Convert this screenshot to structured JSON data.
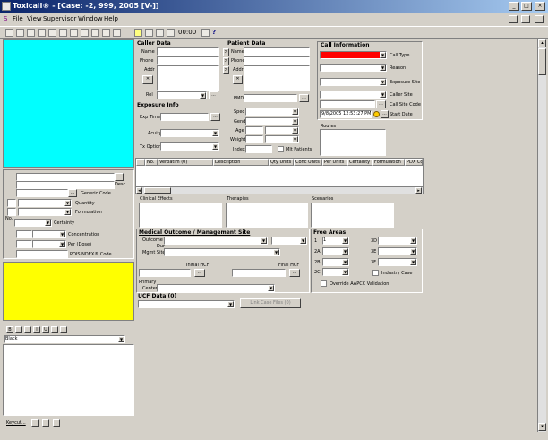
{
  "window": {
    "title": "Toxicall® - [Case: -2, 999, 2005 [V-]]"
  },
  "menu": [
    "File",
    "View",
    "Supervisor",
    "Window",
    "Help"
  ],
  "toolbar": {
    "timer": "00:00"
  },
  "caller": {
    "header": "Caller Data",
    "name_label": "Name",
    "phone_label": "Phone",
    "addr_label": "Addr",
    "rel_label": "Rel"
  },
  "patient": {
    "header": "Patient Data",
    "name_label": "Name",
    "phone_label": "Phone",
    "addr_label": "Addr",
    "pmd_label": "PMD",
    "spec_label": "Spec",
    "gend_label": "Gend",
    "age_label": "Age",
    "weight_label": "Weight",
    "indexr_label": "Index",
    "mult_label": "Mlt Patients"
  },
  "call_info": {
    "header": "Call Information",
    "call_type": "Call Type",
    "reason": "Reason",
    "exposure_site": "Exposure Site",
    "caller_site": "Caller Site",
    "call_site_code": "Call Site Code",
    "start_date_value": "9/8/2005 12:53:27 PM",
    "start_date_label": "Start Date"
  },
  "exposure": {
    "header": "Exposure Info",
    "exp_time": "Exp Time",
    "acuity": "Acuity",
    "tx_option": "Tx Option"
  },
  "routes": {
    "label": "Routes"
  },
  "grid": {
    "columns": [
      "No.",
      "Verbatim (0)",
      "Description",
      "Qty Units",
      "Conc Units",
      "Per Units",
      "Certainty",
      "Formulation",
      "PDX Co"
    ]
  },
  "effects": {
    "clinical": "Clinical Effects",
    "therapies": "Therapies",
    "scenarios": "Scenarios"
  },
  "outcome": {
    "header": "Medical Outcome / Management Site",
    "outcome_label": "Outcome /",
    "dur_label": "Dur",
    "mgmt_site": "Mgmt Site",
    "initial_hcf": "Initial HCF",
    "final_hcf": "Final HCF",
    "primary": "Primary",
    "center": "Center"
  },
  "free_areas": {
    "header": "Free Areas",
    "rows": [
      {
        "l": "1",
        "v": "1",
        "r": "3D"
      },
      {
        "l": "2A",
        "v": "",
        "r": "3E"
      },
      {
        "l": "2B",
        "v": "",
        "r": "3F"
      },
      {
        "l": "2C",
        "v": "",
        "r": ""
      }
    ],
    "industry": "Industry Case",
    "override": "Override AAPCC Validation"
  },
  "ucf": {
    "header": "UCF Data (0)",
    "link_button": "Link Case Files (0)"
  },
  "left": {
    "desc": "Desc",
    "generic_code": "Generic Code",
    "quantity": "Quantity",
    "formulation": "Formulation",
    "no": "No.",
    "certainty": "Certainty",
    "concentration": "Concentration",
    "per_dose": "Per (Dose)",
    "poisindex": "POISINDEX® Code",
    "font_value": "Black",
    "keycut": "Keycut..."
  },
  "colors": {
    "cyan": "#00ffff",
    "yellow": "#ffff00",
    "red": "#ff0000"
  }
}
